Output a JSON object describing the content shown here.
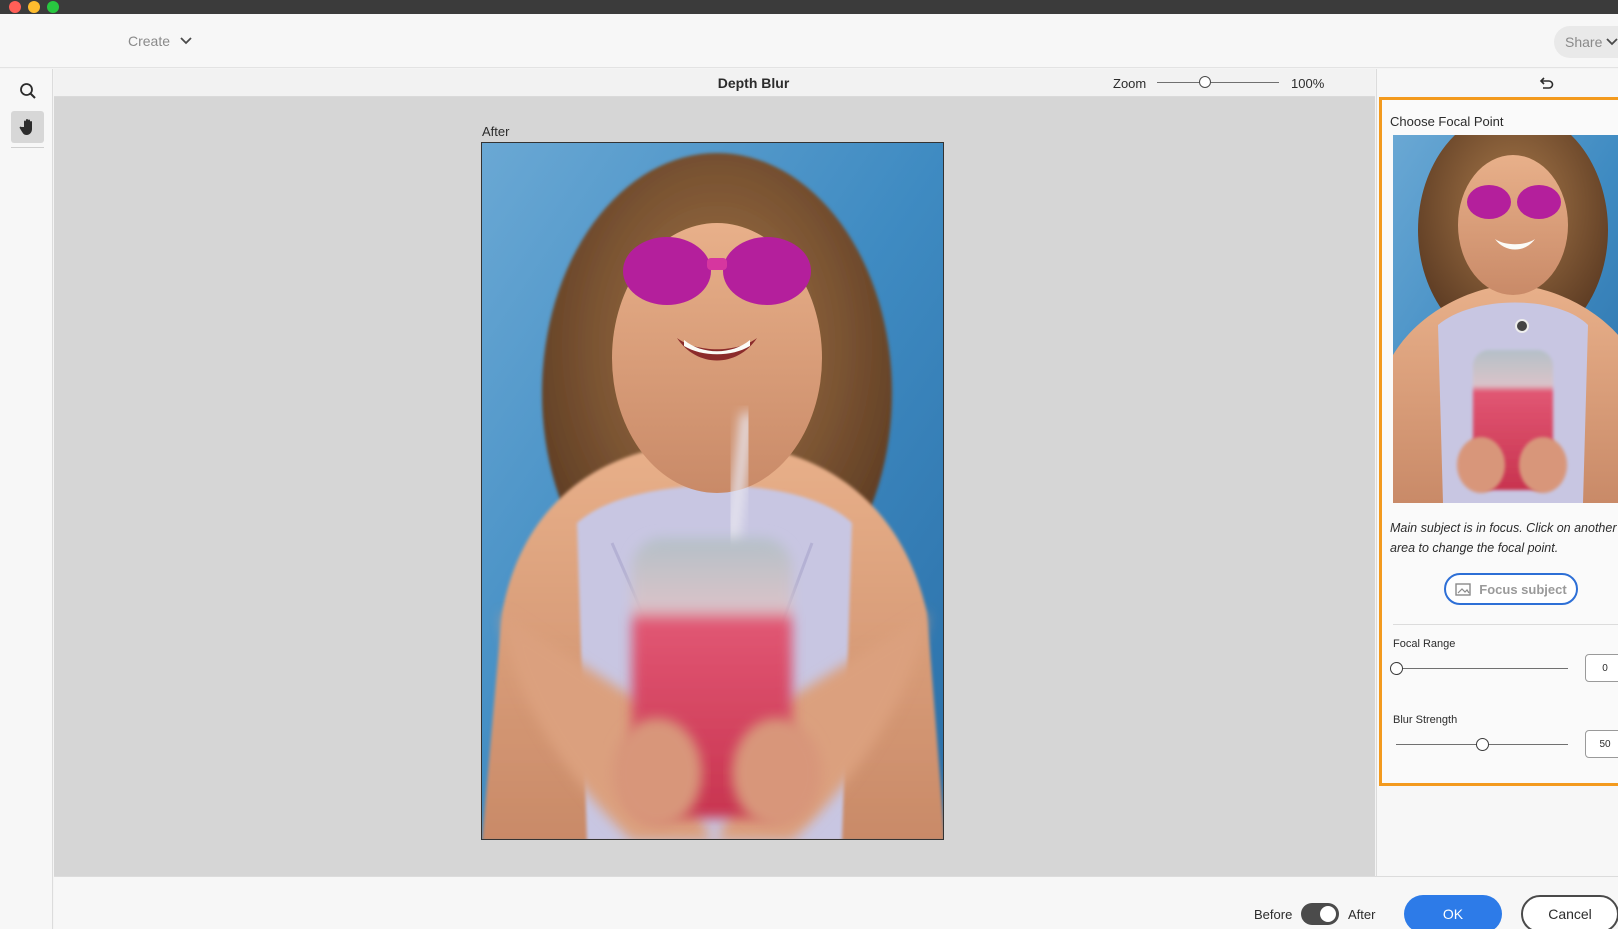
{
  "toolbar": {
    "create_label": "Create",
    "share_label": "Share"
  },
  "tools": [
    {
      "icon": "search-icon"
    },
    {
      "icon": "hand-icon",
      "selected": true
    }
  ],
  "canvas": {
    "title": "Depth Blur",
    "zoom_label": "Zoom",
    "zoom_value": "100%",
    "view_label": "After"
  },
  "panel": {
    "title": "Choose Focal Point",
    "description": "Main subject is in focus. Click on another area to change the focal point.",
    "focus_button_label": "Focus subject",
    "focal_range": {
      "label": "Focal Range",
      "value": "0",
      "fraction": 0.0
    },
    "blur_strength": {
      "label": "Blur Strength",
      "value": "50",
      "fraction": 0.5
    }
  },
  "footer": {
    "before_label": "Before",
    "after_label": "After",
    "toggle_state": "After",
    "ok_label": "OK",
    "cancel_label": "Cancel"
  },
  "colors": {
    "accent_blue": "#2d7be8",
    "panel_highlight": "#f39a1e",
    "canvas_bg": "#d6d6d6"
  }
}
